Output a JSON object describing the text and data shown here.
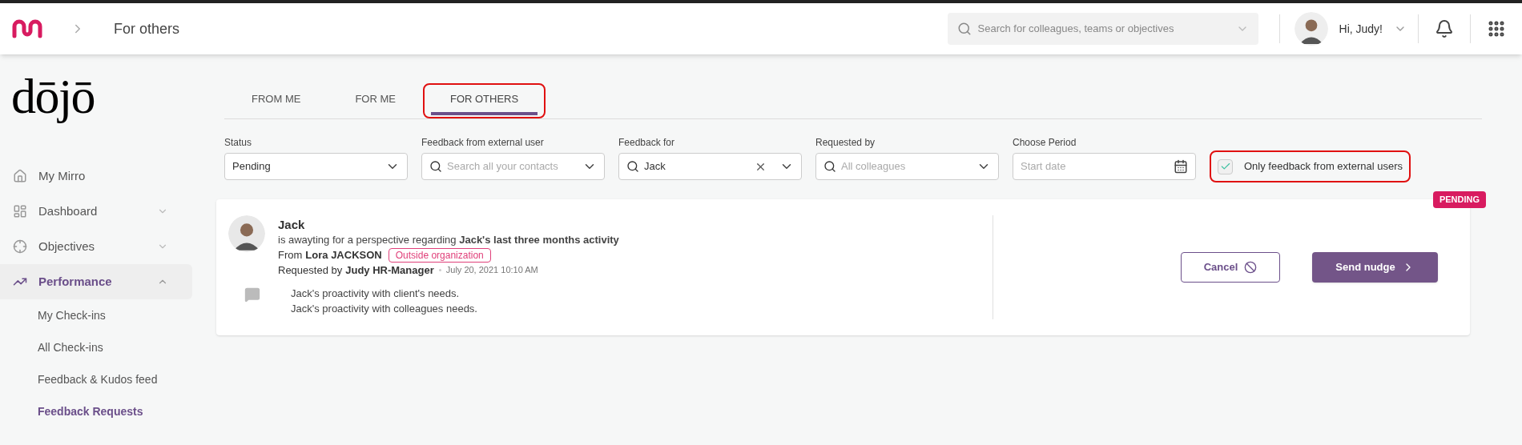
{
  "header": {
    "breadcrumb": "For others",
    "search": {
      "placeholder": "Search for colleagues, teams or objectives"
    },
    "greeting": "Hi, Judy!"
  },
  "sidebar": {
    "logo": "dōjō",
    "items": [
      {
        "label": "My Mirro",
        "kind": "link",
        "selected": false
      },
      {
        "label": "Dashboard",
        "kind": "group",
        "selected": false,
        "expanded": false
      },
      {
        "label": "Objectives",
        "kind": "group",
        "selected": false,
        "expanded": false
      },
      {
        "label": "Performance",
        "kind": "group",
        "selected": true,
        "expanded": true,
        "children": [
          {
            "label": "My Check-ins",
            "selected": false
          },
          {
            "label": "All Check-ins",
            "selected": false
          },
          {
            "label": "Feedback & Kudos feed",
            "selected": false
          },
          {
            "label": "Feedback Requests",
            "selected": true
          }
        ]
      }
    ]
  },
  "tabs": [
    {
      "label": "FROM ME",
      "selected": false,
      "highlighted": false
    },
    {
      "label": "FOR ME",
      "selected": false,
      "highlighted": false
    },
    {
      "label": "FOR OTHERS",
      "selected": true,
      "highlighted": true
    }
  ],
  "filters": [
    {
      "label": "Status",
      "kind": "select",
      "value": "Pending"
    },
    {
      "label": "Feedback from external user",
      "kind": "search",
      "placeholder": "Search all your contacts"
    },
    {
      "label": "Feedback for",
      "kind": "search",
      "value": "Jack"
    },
    {
      "label": "Requested by",
      "kind": "search",
      "placeholder": "All colleagues"
    },
    {
      "label": "Choose Period",
      "kind": "date",
      "placeholder": "Start date"
    }
  ],
  "external_only": {
    "label": "Only feedback from external users",
    "checked": true,
    "highlighted": true
  },
  "requests": [
    {
      "status": "PENDING",
      "name": "Jack",
      "text": "is awayting for a perspective regarding **Jack's last three months activity**",
      "from_label": "From",
      "from": "Lora JACKSON",
      "tag": "Outside organization",
      "requested_label": "Requested by",
      "requested_by": "Judy HR-Manager",
      "date": "July 20, 2021 10:10 AM",
      "questions": [
        "Jack's proactivity with client's needs.",
        "Jack's proactivity with colleagues needs."
      ],
      "cancel": "Cancel",
      "nudge": "Send nudge"
    }
  ]
}
